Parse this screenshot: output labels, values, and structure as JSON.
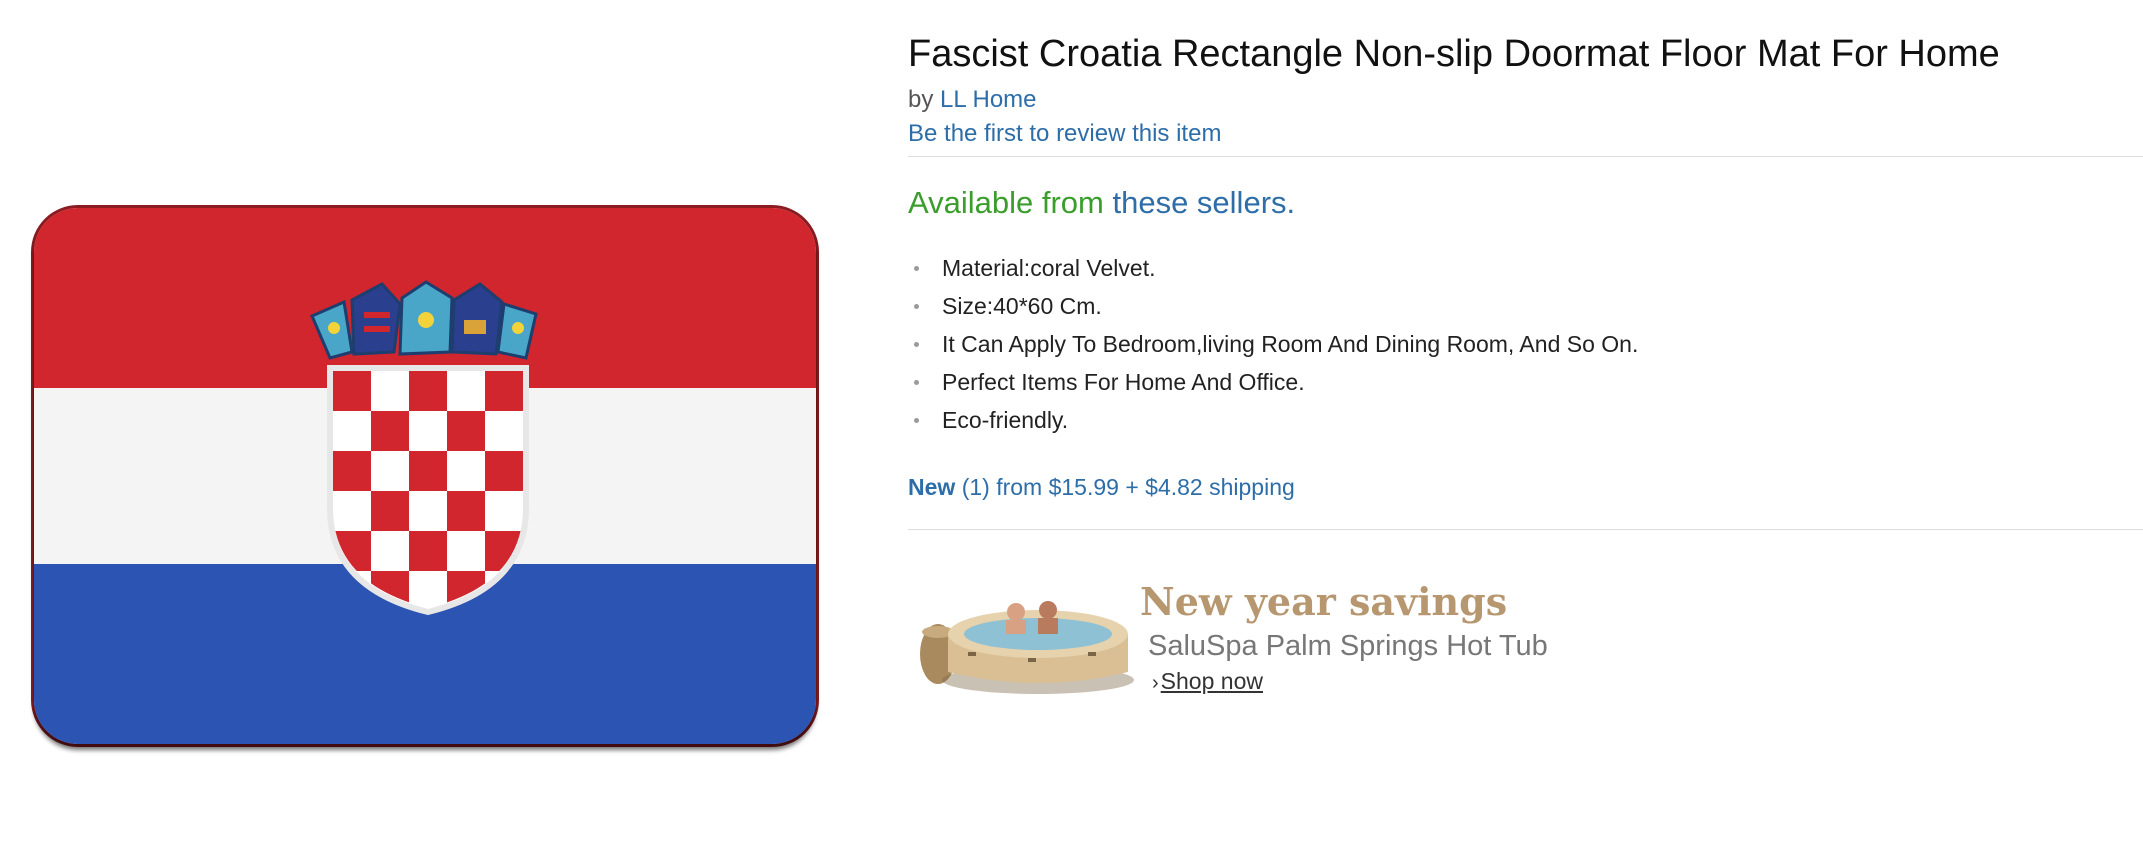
{
  "product": {
    "title": "Fascist Croatia Rectangle Non-slip Doormat Floor Mat For Home",
    "by_prefix": "by",
    "brand": "LL Home",
    "review_link": "Be the first to review this item",
    "availability_prefix": "Available from",
    "availability_link": "these sellers.",
    "bullets": [
      "Material:coral Velvet.",
      "Size:40*60 Cm.",
      "It Can Apply To Bedroom,living Room And Dining Room, And So On.",
      "Perfect Items For Home And Office.",
      "Eco-friendly."
    ],
    "offer": {
      "new_label": "New",
      "count": "(1) from",
      "price": "$15.99",
      "plus": "+",
      "shipping": "$4.82 shipping"
    }
  },
  "ad": {
    "headline": "New year savings",
    "subtitle": "SaluSpa Palm Springs Hot Tub",
    "cta": "Shop now"
  },
  "colors": {
    "link": "#2d6da8",
    "available_green": "#3a9d2c",
    "flag_red": "#d1262d",
    "flag_white": "#f4f4f4",
    "flag_blue": "#2b54b3",
    "ad_gold": "#b79770"
  }
}
